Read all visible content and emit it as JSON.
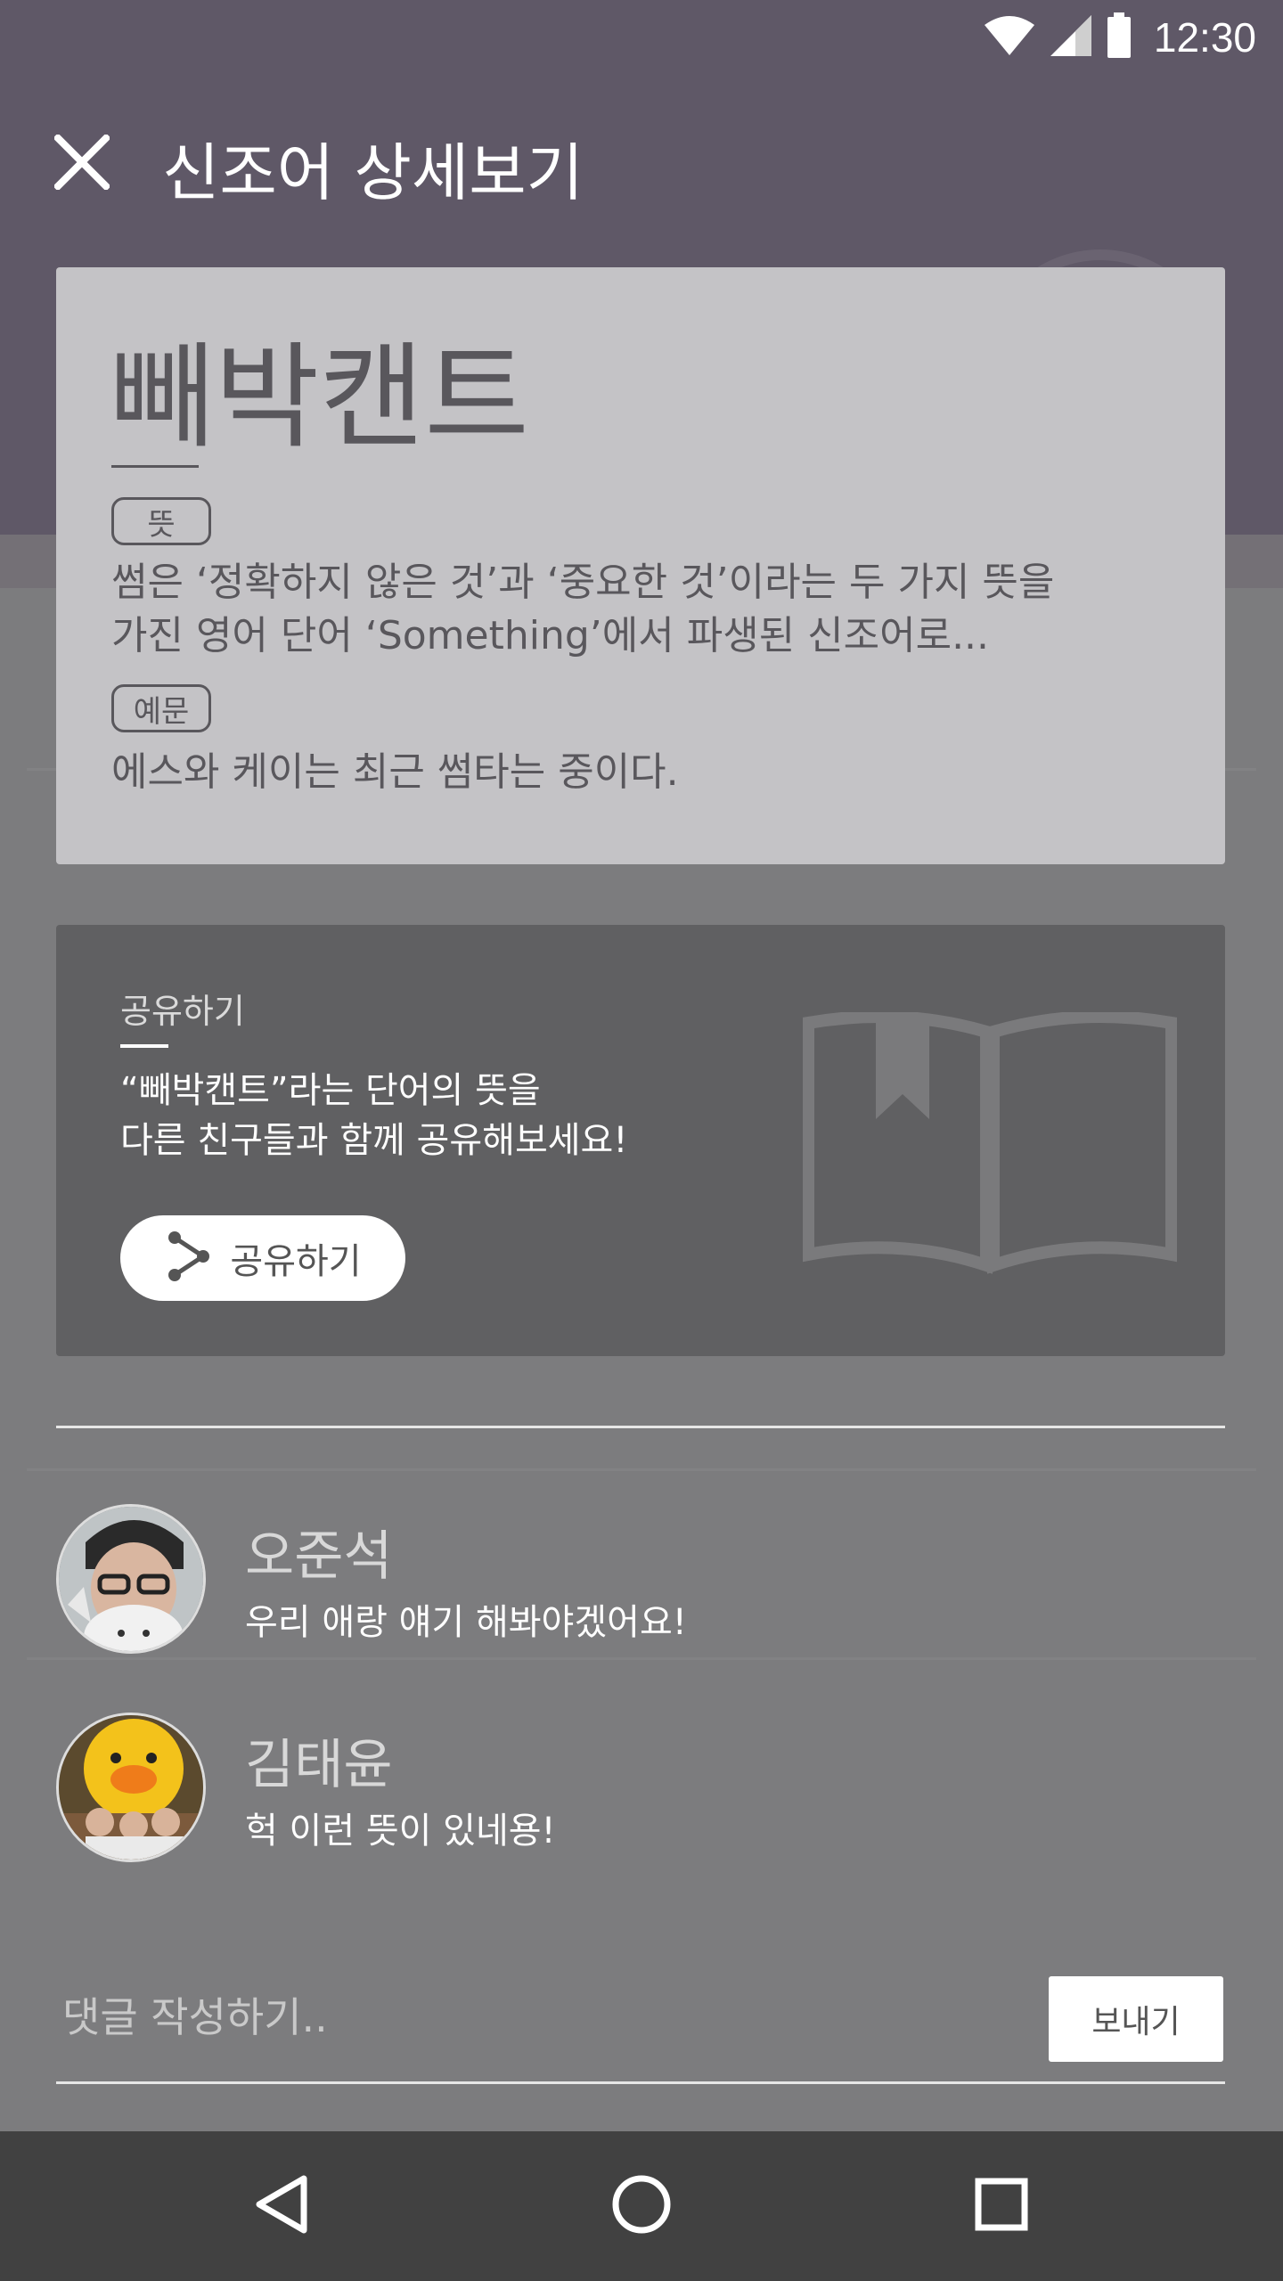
{
  "status_bar": {
    "time": "12:30",
    "icons": [
      "wifi-icon",
      "cellular-signal-icon",
      "battery-icon"
    ]
  },
  "dialog": {
    "title": "신조어 상세보기",
    "close_icon": "close-icon"
  },
  "word_card": {
    "word": "빼박캔트",
    "meaning_tag": "뜻",
    "meaning": "썸은 ‘정확하지 않은 것’과 ‘중요한 것’이라는 두 가지 뜻을 가진 영어 단어 ‘Something’에서 파생된 신조어로...",
    "example_tag": "예문",
    "example": "에스와 케이는 최근 썸타는 중이다."
  },
  "share_card": {
    "label": "공유하기",
    "description_line1": "“빼박캔트”라는 단어의 뜻을",
    "description_line2": "다른 친구들과 함께 공유해보세요!",
    "button_label": "공유하기",
    "button_icon": "share-icon",
    "decoration_icon": "book-icon"
  },
  "comments": [
    {
      "name": "오준석",
      "text": "우리 애랑 얘기 해봐야겠어요!"
    },
    {
      "name": "김태윤",
      "text": "헉 이런 뜻이 있네용!"
    }
  ],
  "comment_input": {
    "placeholder": "댓글 작성하기..",
    "value": "",
    "send_label": "보내기"
  },
  "nav_bar": {
    "icons": [
      "back-icon",
      "home-icon",
      "recents-icon"
    ]
  },
  "colors": {
    "card_bg": "#c4c3c6",
    "card_text": "#59575c",
    "share_bg": "#606062",
    "nav_bg": "#414141"
  }
}
